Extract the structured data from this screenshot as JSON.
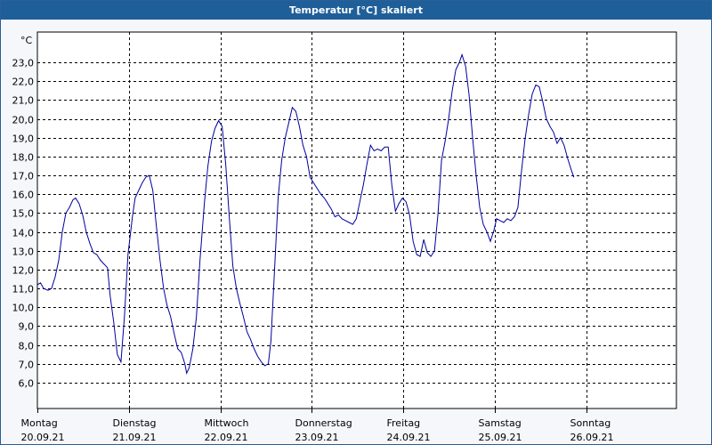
{
  "window": {
    "title": "Temperatur [°C] skaliert",
    "title_bg": "#1e5f99",
    "title_fg": "#ffffff"
  },
  "chart_data": {
    "type": "line",
    "title": "Temperatur [°C] skaliert",
    "unit_label": "°C",
    "xlabel": "",
    "ylabel": "",
    "ylim": [
      6.0,
      23.0
    ],
    "yticks": [
      6.0,
      7.0,
      8.0,
      9.0,
      10.0,
      11.0,
      12.0,
      13.0,
      14.0,
      15.0,
      16.0,
      17.0,
      18.0,
      19.0,
      20.0,
      21.0,
      22.0,
      23.0
    ],
    "ytick_labels": [
      "6,0",
      "7,0",
      "8,0",
      "9,0",
      "10,0",
      "11,0",
      "12,0",
      "13,0",
      "14,0",
      "15,0",
      "16,0",
      "17,0",
      "18,0",
      "19,0",
      "20,0",
      "21,0",
      "22,0",
      "23,0"
    ],
    "xlim": [
      0,
      7
    ],
    "x_unit": "days since Montag 20.09.21 00:00",
    "day_labels": [
      {
        "day": "Montag",
        "date": "20.09.21"
      },
      {
        "day": "Dienstag",
        "date": "21.09.21"
      },
      {
        "day": "Mittwoch",
        "date": "22.09.21"
      },
      {
        "day": "Donnerstag",
        "date": "23.09.21"
      },
      {
        "day": "Freitag",
        "date": "24.09.21"
      },
      {
        "day": "Samstag",
        "date": "25.09.21"
      },
      {
        "day": "Sonntag",
        "date": "26.09.21"
      }
    ],
    "grid": true,
    "line_color": "#0000a0",
    "series": [
      {
        "points": [
          [
            0.0,
            11.2
          ],
          [
            0.034,
            11.3
          ],
          [
            0.068,
            11.0
          ],
          [
            0.117,
            10.9
          ],
          [
            0.155,
            11.0
          ],
          [
            0.194,
            11.6
          ],
          [
            0.233,
            12.5
          ],
          [
            0.272,
            14.0
          ],
          [
            0.311,
            15.0
          ],
          [
            0.35,
            15.3
          ],
          [
            0.388,
            15.7
          ],
          [
            0.417,
            15.8
          ],
          [
            0.456,
            15.5
          ],
          [
            0.495,
            14.9
          ],
          [
            0.534,
            14.0
          ],
          [
            0.573,
            13.4
          ],
          [
            0.612,
            12.9
          ],
          [
            0.65,
            12.8
          ],
          [
            0.689,
            12.5
          ],
          [
            0.728,
            12.3
          ],
          [
            0.767,
            12.1
          ],
          [
            0.796,
            10.6
          ],
          [
            0.835,
            9.2
          ],
          [
            0.874,
            7.5
          ],
          [
            0.913,
            7.1
          ],
          [
            0.951,
            9.5
          ],
          [
            0.99,
            12.8
          ],
          [
            1.039,
            14.8
          ],
          [
            1.068,
            15.8
          ],
          [
            1.107,
            16.2
          ],
          [
            1.146,
            16.6
          ],
          [
            1.184,
            16.9
          ],
          [
            1.223,
            17.0
          ],
          [
            1.262,
            16.2
          ],
          [
            1.301,
            14.3
          ],
          [
            1.34,
            12.5
          ],
          [
            1.379,
            11.0
          ],
          [
            1.417,
            10.1
          ],
          [
            1.456,
            9.5
          ],
          [
            1.495,
            8.6
          ],
          [
            1.534,
            7.8
          ],
          [
            1.573,
            7.6
          ],
          [
            1.612,
            7.0
          ],
          [
            1.631,
            6.5
          ],
          [
            1.66,
            6.8
          ],
          [
            1.699,
            7.8
          ],
          [
            1.738,
            9.5
          ],
          [
            1.777,
            12.5
          ],
          [
            1.825,
            15.5
          ],
          [
            1.864,
            17.5
          ],
          [
            1.903,
            18.8
          ],
          [
            1.942,
            19.5
          ],
          [
            1.981,
            19.9
          ],
          [
            2.019,
            19.6
          ],
          [
            2.058,
            17.6
          ],
          [
            2.097,
            14.8
          ],
          [
            2.136,
            12.2
          ],
          [
            2.175,
            11.0
          ],
          [
            2.214,
            10.2
          ],
          [
            2.252,
            9.5
          ],
          [
            2.291,
            8.7
          ],
          [
            2.33,
            8.3
          ],
          [
            2.369,
            7.8
          ],
          [
            2.408,
            7.4
          ],
          [
            2.447,
            7.1
          ],
          [
            2.485,
            6.9
          ],
          [
            2.524,
            7.0
          ],
          [
            2.553,
            8.2
          ],
          [
            2.592,
            12.0
          ],
          [
            2.631,
            15.8
          ],
          [
            2.67,
            17.8
          ],
          [
            2.709,
            19.0
          ],
          [
            2.748,
            19.8
          ],
          [
            2.786,
            20.6
          ],
          [
            2.825,
            20.4
          ],
          [
            2.864,
            19.6
          ],
          [
            2.903,
            18.6
          ],
          [
            2.942,
            18.0
          ],
          [
            2.981,
            16.9
          ],
          [
            3.019,
            16.6
          ],
          [
            3.058,
            16.3
          ],
          [
            3.097,
            16.0
          ],
          [
            3.136,
            15.8
          ],
          [
            3.175,
            15.5
          ],
          [
            3.214,
            15.2
          ],
          [
            3.252,
            14.8
          ],
          [
            3.291,
            14.9
          ],
          [
            3.33,
            14.7
          ],
          [
            3.369,
            14.6
          ],
          [
            3.408,
            14.5
          ],
          [
            3.447,
            14.4
          ],
          [
            3.485,
            14.7
          ],
          [
            3.524,
            15.6
          ],
          [
            3.563,
            16.5
          ],
          [
            3.602,
            17.6
          ],
          [
            3.641,
            18.6
          ],
          [
            3.68,
            18.3
          ],
          [
            3.718,
            18.4
          ],
          [
            3.757,
            18.3
          ],
          [
            3.796,
            18.5
          ],
          [
            3.835,
            18.5
          ],
          [
            3.874,
            16.5
          ],
          [
            3.913,
            15.1
          ],
          [
            3.951,
            15.5
          ],
          [
            3.99,
            15.8
          ],
          [
            4.029,
            15.6
          ],
          [
            4.068,
            14.9
          ],
          [
            4.107,
            13.5
          ],
          [
            4.146,
            12.8
          ],
          [
            4.184,
            12.7
          ],
          [
            4.223,
            13.6
          ],
          [
            4.262,
            12.9
          ],
          [
            4.301,
            12.7
          ],
          [
            4.34,
            13.0
          ],
          [
            4.379,
            15.0
          ],
          [
            4.417,
            17.8
          ],
          [
            4.456,
            18.8
          ],
          [
            4.495,
            20.0
          ],
          [
            4.534,
            21.5
          ],
          [
            4.573,
            22.6
          ],
          [
            4.612,
            23.0
          ],
          [
            4.641,
            23.4
          ],
          [
            4.68,
            22.8
          ],
          [
            4.718,
            21.3
          ],
          [
            4.757,
            19.0
          ],
          [
            4.796,
            17.0
          ],
          [
            4.835,
            15.3
          ],
          [
            4.874,
            14.4
          ],
          [
            4.913,
            14.0
          ],
          [
            4.951,
            13.5
          ],
          [
            4.99,
            14.1
          ],
          [
            5.019,
            14.7
          ],
          [
            5.058,
            14.6
          ],
          [
            5.097,
            14.5
          ],
          [
            5.136,
            14.7
          ],
          [
            5.175,
            14.6
          ],
          [
            5.214,
            14.8
          ],
          [
            5.252,
            15.3
          ],
          [
            5.291,
            17.2
          ],
          [
            5.33,
            18.9
          ],
          [
            5.369,
            20.2
          ],
          [
            5.408,
            21.3
          ],
          [
            5.447,
            21.8
          ],
          [
            5.485,
            21.7
          ],
          [
            5.524,
            20.9
          ],
          [
            5.563,
            20.0
          ],
          [
            5.602,
            19.6
          ],
          [
            5.641,
            19.3
          ],
          [
            5.68,
            18.7
          ],
          [
            5.718,
            19.0
          ],
          [
            5.757,
            18.6
          ],
          [
            5.796,
            17.9
          ],
          [
            5.835,
            17.3
          ],
          [
            5.864,
            16.9
          ]
        ]
      }
    ]
  }
}
